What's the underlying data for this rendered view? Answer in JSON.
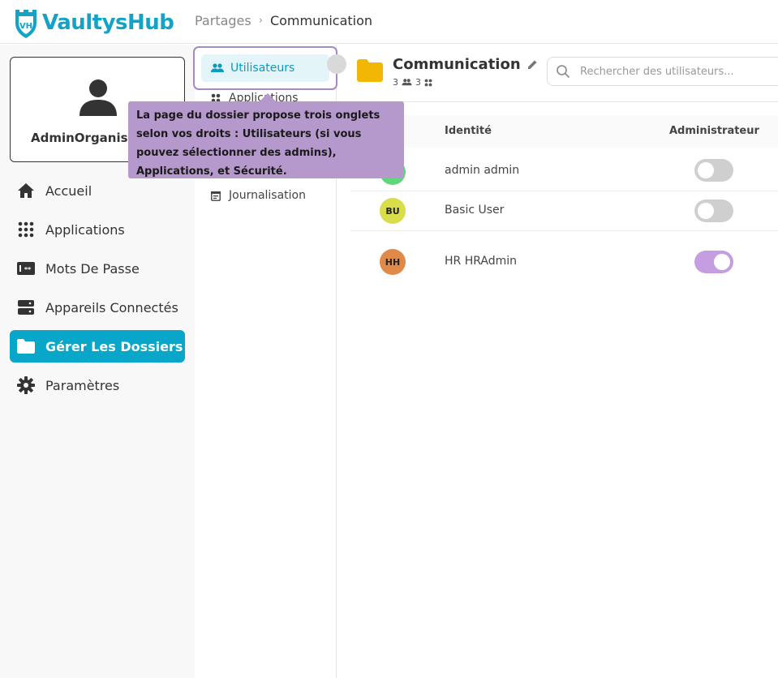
{
  "app": {
    "name": "VaultysHub",
    "logo_badge": "VH"
  },
  "breadcrumb": {
    "parent": "Partages",
    "separator": "›",
    "current": "Communication"
  },
  "profile": {
    "name": "AdminOrganisation"
  },
  "sidebar": {
    "items": [
      {
        "label": "Accueil",
        "icon": "home-icon"
      },
      {
        "label": "Applications",
        "icon": "apps-grid-icon"
      },
      {
        "label": "Mots De Passe",
        "icon": "password-icon"
      },
      {
        "label": "Appareils Connectés",
        "icon": "devices-icon"
      },
      {
        "label": "Gérer Les Dossiers",
        "icon": "folder-icon",
        "active": true
      },
      {
        "label": "Paramètres",
        "icon": "gear-icon"
      }
    ]
  },
  "subnav": {
    "tabs": [
      {
        "label": "Utilisateurs",
        "icon": "users-icon",
        "active": true
      },
      {
        "label": "Applications",
        "icon": "apps-icon"
      },
      {
        "label": "Journalisation",
        "icon": "log-icon"
      }
    ]
  },
  "tooltip": {
    "text": "La page du dossier propose trois onglets selon vos droits : Utilisateurs (si vous pouvez sélectionner des admins), Applications, et Sécurité."
  },
  "folder": {
    "title": "Communication",
    "users_count": "3",
    "apps_count": "3"
  },
  "search": {
    "placeholder": "Rechercher des utilisateurs..."
  },
  "table": {
    "columns": {
      "identity": "Identité",
      "admin": "Administrateur"
    },
    "rows": [
      {
        "initials": "",
        "name": "admin admin",
        "avatar_color": "#5fd67a",
        "admin": false
      },
      {
        "initials": "BU",
        "name": "Basic User",
        "avatar_color": "#d9dd4a",
        "admin": false
      },
      {
        "initials": "HH",
        "name": "HR HRAdmin",
        "avatar_color": "#e08a4a",
        "admin": true
      }
    ]
  },
  "colors": {
    "accent": "#08a6c9",
    "tooltip": "#b598cc",
    "toggle_on": "#c49ee0"
  }
}
